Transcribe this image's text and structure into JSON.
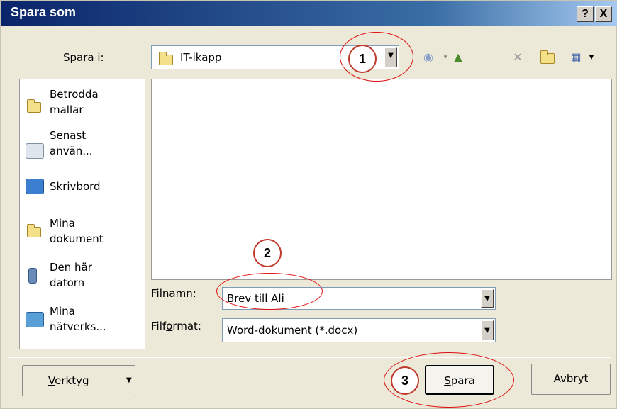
{
  "window": {
    "title": "Spara som",
    "help_label": "?",
    "close_label": "X"
  },
  "save_in": {
    "label_pre": "Spara ",
    "label_key": "i",
    "label_post": ":",
    "value": "IT-ikapp"
  },
  "places": [
    {
      "line1": "Betrodda",
      "line2": "mallar",
      "icon": "folder-icon"
    },
    {
      "line1": "Senast",
      "line2": "använ...",
      "icon": "recent-icon"
    },
    {
      "line1": "Skrivbord",
      "line2": "",
      "icon": "desktop-icon"
    },
    {
      "line1": "Mina",
      "line2": "dokument",
      "icon": "documents-icon"
    },
    {
      "line1": "Den här",
      "line2": "datorn",
      "icon": "computer-icon"
    },
    {
      "line1": "Mina",
      "line2": "nätverks...",
      "icon": "network-icon"
    }
  ],
  "filename": {
    "label_key": "F",
    "label_rest": "ilnamn:",
    "value": "Brev till Ali"
  },
  "fileformat": {
    "label_pre": "Filf",
    "label_key": "o",
    "label_post": "rmat:",
    "value": "Word-dokument (*.docx)"
  },
  "buttons": {
    "tools_key": "V",
    "tools_rest": "erktyg",
    "save_key": "S",
    "save_rest": "para",
    "cancel": "Avbryt"
  },
  "callouts": {
    "one": "1",
    "two": "2",
    "three": "3"
  },
  "colors": {
    "titlebar": "#0a246a",
    "dialog": "#ece9d8",
    "callout": "#c0392b"
  }
}
